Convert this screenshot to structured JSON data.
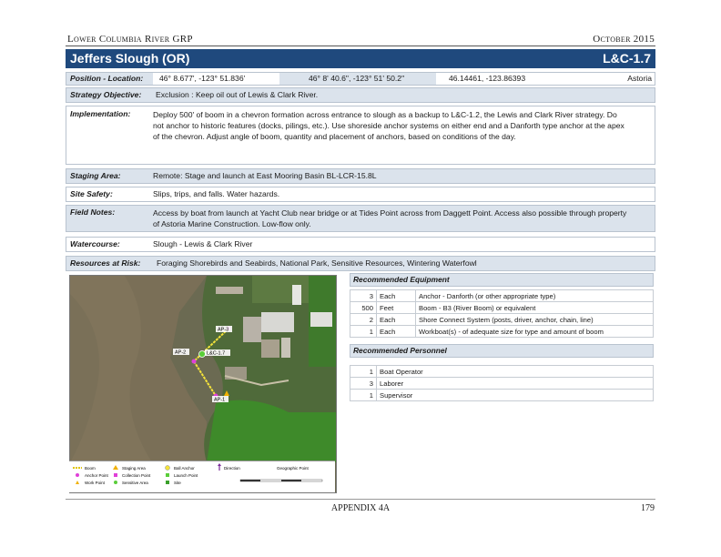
{
  "header": {
    "left": "Lower Columbia River GRP",
    "right": "October 2015"
  },
  "title": {
    "name": "Jeffers Slough (OR)",
    "code": "L&C-1.7"
  },
  "position": {
    "label": "Position - Location:",
    "dms1": "46° 8.677', -123° 51.836'",
    "dms2": "46° 8' 40.6\", -123° 51' 50.2\"",
    "decimal": "46.14461, -123.86393",
    "location": "Astoria"
  },
  "strategy": {
    "label": "Strategy Objective:",
    "value": "Exclusion :   Keep oil out of Lewis & Clark River."
  },
  "implementation": {
    "label": "Implementation:",
    "line1": "Deploy 500' of boom in a chevron formation across entrance to slough as a backup to L&C-1.2, the Lewis and Clark River strategy.  Do",
    "line2": "not anchor to historic features (docks, pilings, etc.). Use shoreside anchor systems on either end and a Danforth type anchor at the apex",
    "line3": "of the chevron. Adjust angle of boom, quantity and placement of anchors, based on conditions of the day."
  },
  "staging": {
    "label": "Staging Area:",
    "value": "Remote:  Stage and launch at East Mooring Basin BL-LCR-15.8L"
  },
  "safety": {
    "label": "Site Safety:",
    "value": "Slips, trips, and falls. Water hazards."
  },
  "field_notes": {
    "label": "Field Notes:",
    "line1": "Access by boat from launch at Yacht Club near bridge or at Tides Point across from Daggett Point.  Access also possible through property",
    "line2": "of Astoria Marine Construction. Low-flow only."
  },
  "watercourse": {
    "label": "Watercourse:",
    "value": "Slough  - Lewis & Clark River"
  },
  "resources": {
    "label": "Resources at Risk:",
    "value": "Foraging Shorebirds and Seabirds, National Park, Sensitive Resources, Wintering Waterfowl"
  },
  "map": {
    "labels": {
      "ap1": "AP-1",
      "ap2": "AP-2",
      "ap3": "AP-3",
      "site": "L&C-1.7"
    },
    "legend": [
      "Boom",
      "Anchor Point",
      "Work Point",
      "Staging Area",
      "Collection Point",
      "Sensitive Area",
      "Ball Anchor",
      "Launch Point",
      "Site",
      "Direction",
      "Geographic Point"
    ]
  },
  "equipment": {
    "title": "Recommended Equipment",
    "rows": [
      {
        "qty": "3",
        "unit": "Each",
        "item": "Anchor - Danforth (or other appropriate type)"
      },
      {
        "qty": "500",
        "unit": "Feet",
        "item": "Boom - B3 (River Boom) or equivalent"
      },
      {
        "qty": "2",
        "unit": "Each",
        "item": "Shore Connect System (posts, driver, anchor, chain, line)"
      },
      {
        "qty": "1",
        "unit": "Each",
        "item": "Workboat(s)  - of adequate size for type and amount of boom"
      }
    ]
  },
  "personnel": {
    "title": "Recommended Personnel",
    "rows": [
      {
        "qty": "1",
        "item": "Boat Operator"
      },
      {
        "qty": "3",
        "item": "Laborer"
      },
      {
        "qty": "1",
        "item": "Supervisor"
      }
    ]
  },
  "footer": {
    "center": "APPENDIX 4A",
    "page": "179"
  },
  "colors": {
    "title_bg": "#1f497d",
    "row_shade": "#dbe3ec"
  }
}
